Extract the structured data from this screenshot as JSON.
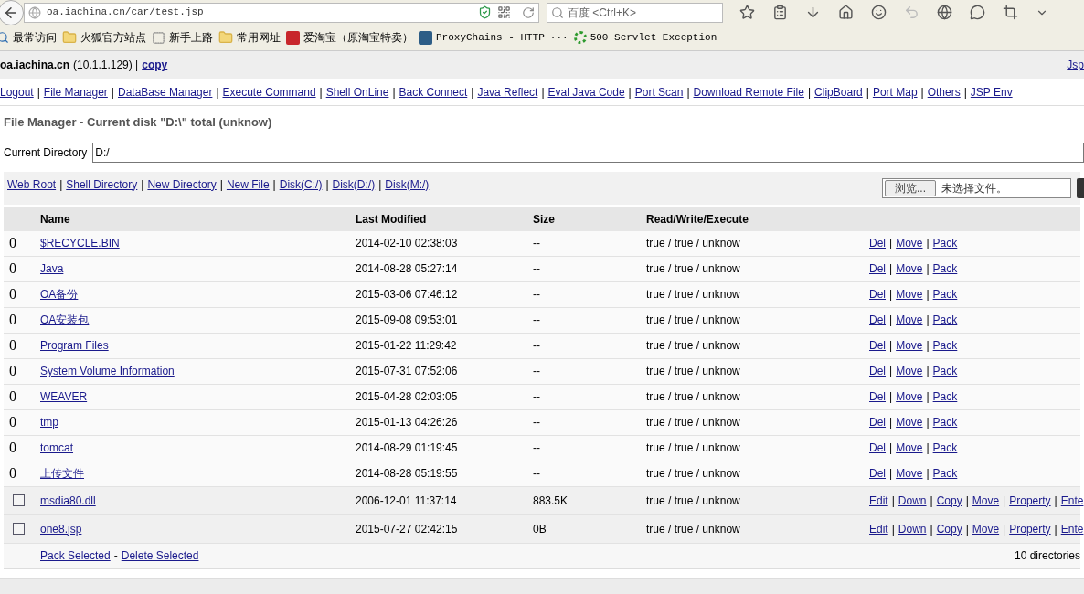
{
  "browser": {
    "url": "oa.iachina.cn/car/test.jsp",
    "search_placeholder": "百度 <Ctrl+K>",
    "bookmarks": [
      "最常访问",
      "火狐官方站点",
      "新手上路",
      "常用网址",
      "爱淘宝（原淘宝特卖）",
      "ProxyChains - HTTP",
      "···",
      "500 Servlet Exception"
    ]
  },
  "header": {
    "host": "oa.iachina.cn",
    "ip": "(10.1.1.129) |",
    "copy_link": "copy",
    "right_link": "Jsp"
  },
  "link_separator": "|",
  "nav": [
    "Logout",
    "File Manager",
    "DataBase Manager",
    "Execute Command",
    "Shell OnLine",
    "Back Connect",
    "Java Reflect",
    "Eval Java Code",
    "Port Scan",
    "Download Remote File",
    "ClipBoard",
    "Port Map",
    "Others",
    "JSP Env"
  ],
  "title": "File Manager - Current disk \"D:\\\" total (unknow)",
  "current_directory": {
    "label": "Current Directory",
    "value": "D:/"
  },
  "dir_links": [
    "Web Root",
    "Shell Directory",
    "New Directory",
    "New File",
    "Disk(C:/)",
    "Disk(D:/)",
    "Disk(M:/)"
  ],
  "upload": {
    "browse": "浏览...",
    "status": "未选择文件。"
  },
  "table": {
    "columns": [
      "Name",
      "Last Modified",
      "Size",
      "Read/Write/Execute"
    ],
    "rows": [
      {
        "kind": "dir",
        "marker": "0",
        "name": "$RECYCLE.BIN",
        "modified": "2014-02-10 02:38:03",
        "size": "--",
        "rwx": "true / true / unknow",
        "actions": [
          "Del",
          "Move",
          "Pack"
        ]
      },
      {
        "kind": "dir",
        "marker": "0",
        "name": "Java",
        "modified": "2014-08-28 05:27:14",
        "size": "--",
        "rwx": "true / true / unknow",
        "actions": [
          "Del",
          "Move",
          "Pack"
        ]
      },
      {
        "kind": "dir",
        "marker": "0",
        "name": "OA备份",
        "modified": "2015-03-06 07:46:12",
        "size": "--",
        "rwx": "true / true / unknow",
        "actions": [
          "Del",
          "Move",
          "Pack"
        ]
      },
      {
        "kind": "dir",
        "marker": "0",
        "name": "OA安装包",
        "modified": "2015-09-08 09:53:01",
        "size": "--",
        "rwx": "true / true / unknow",
        "actions": [
          "Del",
          "Move",
          "Pack"
        ]
      },
      {
        "kind": "dir",
        "marker": "0",
        "name": "Program Files",
        "modified": "2015-01-22 11:29:42",
        "size": "--",
        "rwx": "true / true / unknow",
        "actions": [
          "Del",
          "Move",
          "Pack"
        ]
      },
      {
        "kind": "dir",
        "marker": "0",
        "name": "System Volume Information",
        "modified": "2015-07-31 07:52:06",
        "size": "--",
        "rwx": "true / true / unknow",
        "actions": [
          "Del",
          "Move",
          "Pack"
        ]
      },
      {
        "kind": "dir",
        "marker": "0",
        "name": "WEAVER",
        "modified": "2015-04-28 02:03:05",
        "size": "--",
        "rwx": "true / true / unknow",
        "actions": [
          "Del",
          "Move",
          "Pack"
        ]
      },
      {
        "kind": "dir",
        "marker": "0",
        "name": "tmp",
        "modified": "2015-01-13 04:26:26",
        "size": "--",
        "rwx": "true / true / unknow",
        "actions": [
          "Del",
          "Move",
          "Pack"
        ]
      },
      {
        "kind": "dir",
        "marker": "0",
        "name": "tomcat",
        "modified": "2014-08-29 01:19:45",
        "size": "--",
        "rwx": "true / true / unknow",
        "actions": [
          "Del",
          "Move",
          "Pack"
        ]
      },
      {
        "kind": "dir",
        "marker": "0",
        "name": "上传文件",
        "modified": "2014-08-28 05:19:55",
        "size": "--",
        "rwx": "true / true / unknow",
        "actions": [
          "Del",
          "Move",
          "Pack"
        ]
      },
      {
        "kind": "file",
        "checked": false,
        "name": "msdia80.dll",
        "modified": "2006-12-01 11:37:14",
        "size": "883.5K",
        "rwx": "true / true / unknow",
        "actions": [
          "Edit",
          "Down",
          "Copy",
          "Move",
          "Property",
          "Ente"
        ]
      },
      {
        "kind": "file",
        "checked": false,
        "name": "one8.jsp",
        "modified": "2015-07-27 02:42:15",
        "size": "0B",
        "rwx": "true / true / unknow",
        "actions": [
          "Edit",
          "Down",
          "Copy",
          "Move",
          "Property",
          "Ente"
        ]
      }
    ]
  },
  "footer": {
    "pack": "Pack Selected",
    "separator": "-",
    "delete": "Delete Selected",
    "summary": "10 directories"
  }
}
